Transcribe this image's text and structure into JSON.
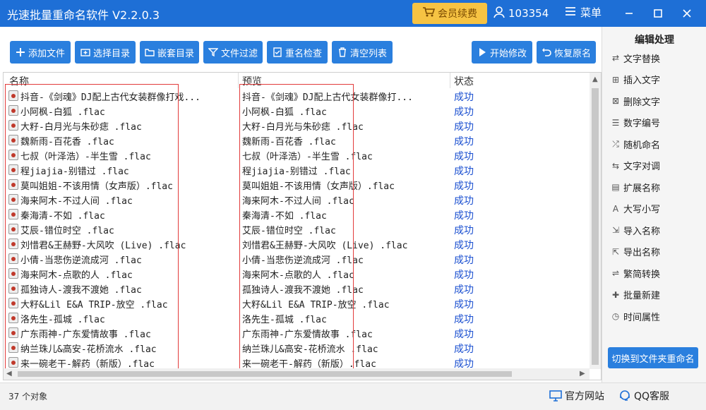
{
  "app": {
    "title": "光速批量重命名软件 V2.2.0.3",
    "vip_label": "会员续费",
    "user_id": "103354",
    "menu_label": "菜单"
  },
  "toolbar": {
    "add_file": "添加文件",
    "select_dir": "选择目录",
    "nested_dir": "嵌套目录",
    "file_filter": "文件过滤",
    "rename_check": "重名检查",
    "clear_list": "清空列表",
    "start_modify": "开始修改",
    "restore_name": "恢复原名"
  },
  "table": {
    "headers": [
      "名称",
      "预览",
      "状态"
    ],
    "rows": [
      {
        "name": "抖音-《剑魂》DJ配上古代女装群像打戏...",
        "preview": "抖音-《剑魂》DJ配上古代女装群像打...",
        "status": "成功"
      },
      {
        "name": "小阿枫-白狐 .flac",
        "preview": "小阿枫-白狐 .flac",
        "status": "成功"
      },
      {
        "name": "大籽-白月光与朱砂痣 .flac",
        "preview": "大籽-白月光与朱砂痣 .flac",
        "status": "成功"
      },
      {
        "name": "魏新雨-百花香 .flac",
        "preview": "魏新雨-百花香 .flac",
        "status": "成功"
      },
      {
        "name": "七叔（叶泽浩）-半生雪 .flac",
        "preview": "七叔（叶泽浩）-半生雪 .flac",
        "status": "成功"
      },
      {
        "name": "程jiajia-别错过 .flac",
        "preview": "程jiajia-别错过 .flac",
        "status": "成功"
      },
      {
        "name": "莫叫姐姐-不该用情（女声版）.flac",
        "preview": "莫叫姐姐-不该用情（女声版）.flac",
        "status": "成功"
      },
      {
        "name": "海来阿木-不过人间 .flac",
        "preview": "海来阿木-不过人间 .flac",
        "status": "成功"
      },
      {
        "name": "秦海清-不如 .flac",
        "preview": "秦海清-不如 .flac",
        "status": "成功"
      },
      {
        "name": "艾辰-错位时空 .flac",
        "preview": "艾辰-错位时空 .flac",
        "status": "成功"
      },
      {
        "name": "刘惜君&王赫野-大风吹 (Live) .flac",
        "preview": "刘惜君&王赫野-大风吹 (Live) .flac",
        "status": "成功"
      },
      {
        "name": "小倩-当悲伤逆流成河 .flac",
        "preview": "小倩-当悲伤逆流成河 .flac",
        "status": "成功"
      },
      {
        "name": "海来阿木-点歌的人 .flac",
        "preview": "海来阿木-点歌的人 .flac",
        "status": "成功"
      },
      {
        "name": "孤独诗人-渡我不渡她 .flac",
        "preview": "孤独诗人-渡我不渡她 .flac",
        "status": "成功"
      },
      {
        "name": "大籽&Lil E&A TRIP-放空 .flac",
        "preview": "大籽&Lil E&A TRIP-放空 .flac",
        "status": "成功"
      },
      {
        "name": "洛先生-孤城 .flac",
        "preview": "洛先生-孤城 .flac",
        "status": "成功"
      },
      {
        "name": "广东雨神-广东爱情故事 .flac",
        "preview": "广东雨神-广东爱情故事 .flac",
        "status": "成功"
      },
      {
        "name": "纳兰珠儿&高安-花桥流水 .flac",
        "preview": "纳兰珠儿&高安-花桥流水 .flac",
        "status": "成功"
      },
      {
        "name": "来一碗老干-解药（新版）.flac",
        "preview": "来一碗老干-解药（新版）.flac",
        "status": "成功"
      }
    ]
  },
  "side_panel": {
    "title": "编辑处理",
    "items": [
      {
        "label": "文字替换",
        "icon": "replace-icon"
      },
      {
        "label": "插入文字",
        "icon": "insert-text-icon"
      },
      {
        "label": "删除文字",
        "icon": "delete-text-icon"
      },
      {
        "label": "数字编号",
        "icon": "number-icon"
      },
      {
        "label": "随机命名",
        "icon": "shuffle-icon"
      },
      {
        "label": "文字对调",
        "icon": "swap-icon"
      },
      {
        "label": "扩展名称",
        "icon": "extension-icon"
      },
      {
        "label": "大写小写",
        "icon": "case-icon"
      },
      {
        "label": "导入名称",
        "icon": "import-icon"
      },
      {
        "label": "导出名称",
        "icon": "export-icon"
      },
      {
        "label": "繁简转换",
        "icon": "convert-icon"
      },
      {
        "label": "批量新建",
        "icon": "new-batch-icon"
      },
      {
        "label": "时间属性",
        "icon": "clock-icon"
      }
    ],
    "switch_label": "切换到文件夹重命名"
  },
  "status_bar": {
    "count": "37 个对象",
    "website": "官方网站",
    "qq_service": "QQ客服"
  },
  "colors": {
    "title_bar": "#1e6fd6",
    "button": "#2a7fde",
    "status_text": "#1a4fd0",
    "highlight_box": "#e23b3b",
    "vip": "#f6c343"
  }
}
